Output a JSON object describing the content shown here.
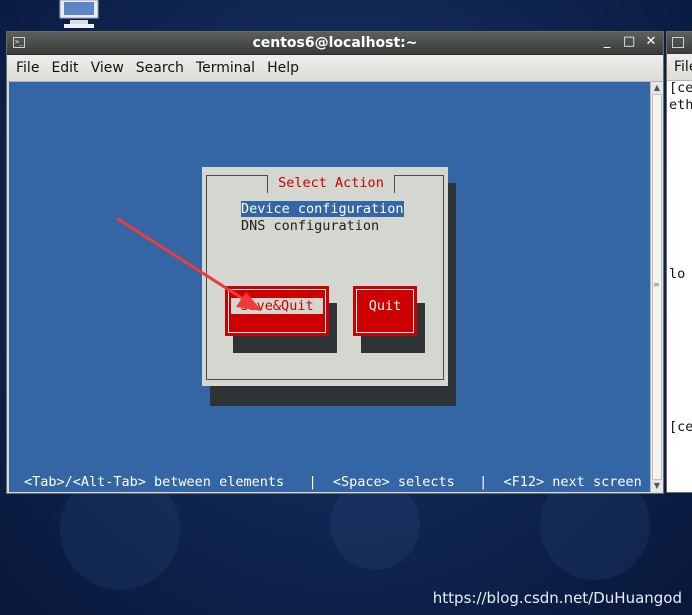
{
  "window": {
    "title": "centos6@localhost:~",
    "buttons": {
      "minimize": "_",
      "maximize": "□",
      "close": "✕"
    }
  },
  "menu": [
    "File",
    "Edit",
    "View",
    "Search",
    "Terminal",
    "Help"
  ],
  "dialog": {
    "title": "Select Action",
    "items": [
      {
        "label": "Device configuration",
        "selected": true
      },
      {
        "label": "DNS configuration",
        "selected": false
      }
    ],
    "buttons": {
      "save_quit": "Save&Quit",
      "quit": "Quit"
    }
  },
  "hint": "<Tab>/<Alt-Tab> between elements   |  <Space> selects   |  <F12> next screen",
  "right_window": {
    "menu": "File",
    "lines": [
      "[ce",
      "eth",
      "lo",
      "[ce"
    ]
  },
  "watermark": "https://blog.csdn.net/DuHuangod",
  "colors": {
    "terminal_bg": "#3465a4",
    "dialog_bg": "#d3d7cf",
    "button_red": "#cc0000",
    "title_red": "#cc0000",
    "arrow": "#f03a3a"
  }
}
